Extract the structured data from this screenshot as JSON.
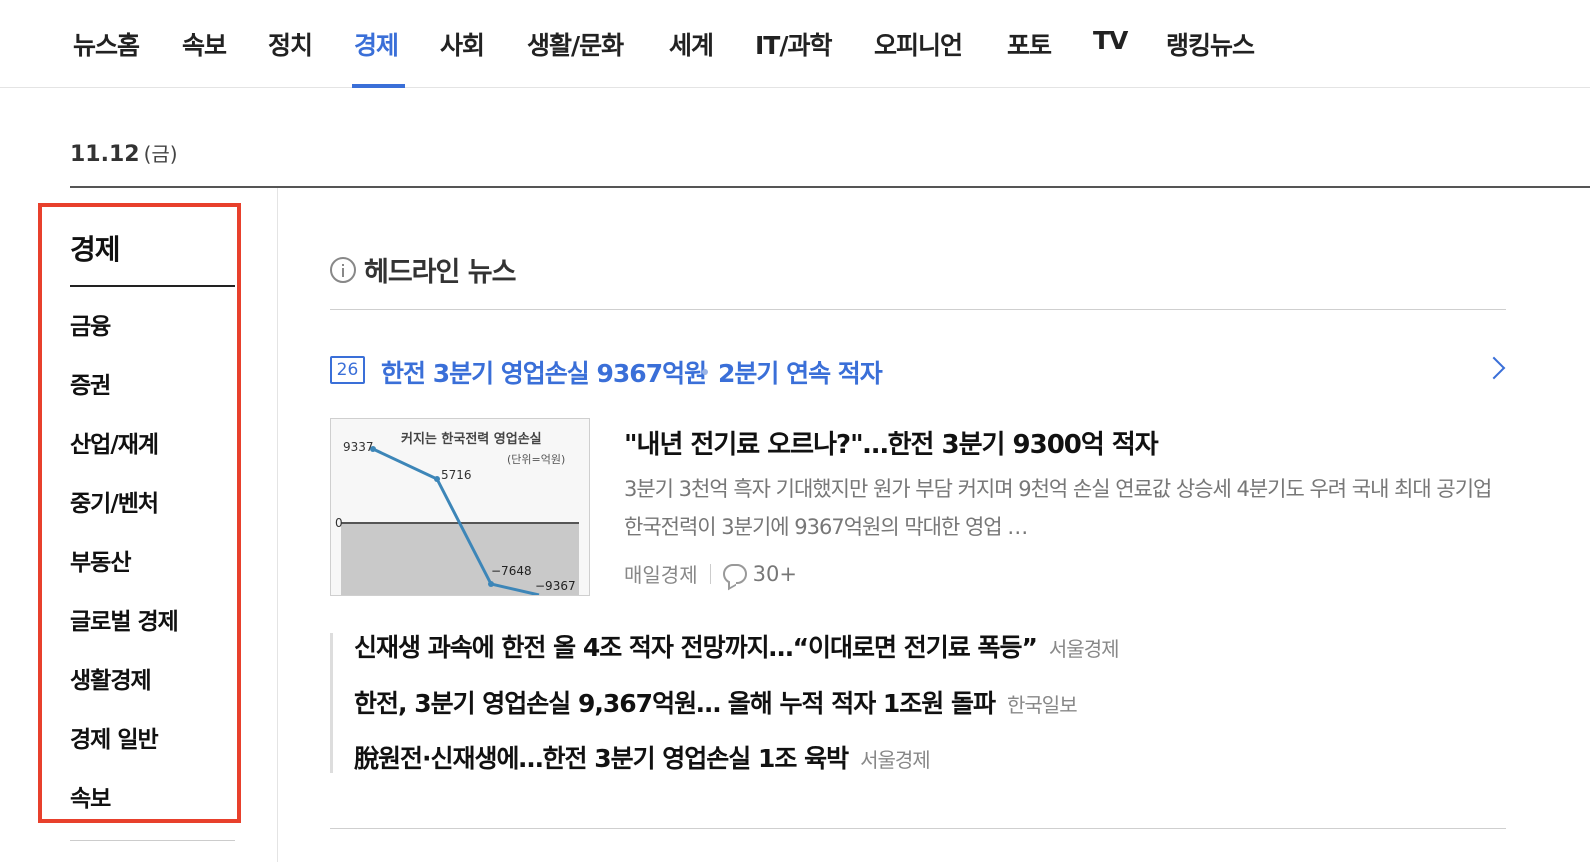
{
  "nav": {
    "items": [
      "뉴스홈",
      "속보",
      "정치",
      "경제",
      "사회",
      "생활/문화",
      "세계",
      "IT/과학",
      "오피니언",
      "포토",
      "TV",
      "랭킹뉴스"
    ],
    "active": "경제",
    "accent_color": "#3a6fd8"
  },
  "date": {
    "day": "11.12",
    "weekday": "(금)"
  },
  "sidebar": {
    "title": "경제",
    "items": [
      "금융",
      "증권",
      "산업/재계",
      "중기/벤처",
      "부동산",
      "글로벌 경제",
      "생활경제",
      "경제 일반",
      "속보"
    ],
    "highlight_color": "#e8402c"
  },
  "headline": {
    "section_title": "헤드라인 뉴스",
    "cluster": {
      "count": "26",
      "title": "한전 3분기 영업손실 9367억원",
      "subtitle": "2분기 연속 적자"
    },
    "main": {
      "title": "\"내년 전기료 오르나?\"…한전 3분기 9300억 적자",
      "summary": "3분기 3천억 흑자 기대했지만 원가 부담 커지며 9천억 손실 연료값 상승세 4분기도 우려 국내 최대 공기업 한국전력이 3분기에 9367억원의 막대한 영업 …",
      "press": "매일경제",
      "comments": "30+",
      "thumbnail": {
        "title": "커지는 한국전력 영업손실",
        "unit": "(단위=억원)",
        "zero_label": "0",
        "point_labels": [
          "9337",
          "5716",
          "−7648",
          "−9367"
        ]
      }
    },
    "related": [
      {
        "title": "신재생 과속에 한전 올 4조 적자 전망까지…“이대로면 전기료 폭등”",
        "press": "서울경제"
      },
      {
        "title": "한전, 3분기 영업손실 9,367억원… 올해 누적 적자 1조원 돌파",
        "press": "한국일보"
      },
      {
        "title": "脫원전·신재생에…한전 3분기 영업손실 1조 육박",
        "press": "서울경제"
      }
    ]
  }
}
